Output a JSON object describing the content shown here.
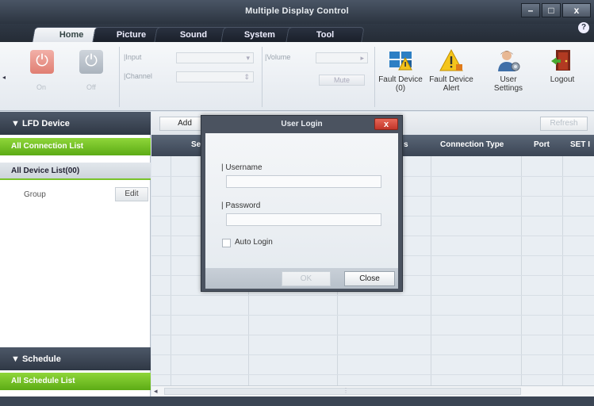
{
  "window": {
    "title": "Multiple Display Control",
    "controls": {
      "minimize": "–",
      "maximize": "□",
      "close": "x"
    }
  },
  "tabs": [
    {
      "label": "Home",
      "active": true
    },
    {
      "label": "Picture",
      "active": false
    },
    {
      "label": "Sound",
      "active": false
    },
    {
      "label": "System",
      "active": false
    },
    {
      "label": "Tool",
      "active": false
    }
  ],
  "help_label": "?",
  "ribbon": {
    "collapse_arrow": "◂",
    "power_on_label": "On",
    "power_off_label": "Off",
    "input_label": "Input",
    "channel_label": "Channel",
    "volume_label": "Volume",
    "mute_label": "Mute",
    "input_arrow": "▾",
    "channel_arrow": "⇕",
    "volume_arrow": "▸",
    "buttons": [
      {
        "label": "Fault Device (0)",
        "icon": "fault-device-icon"
      },
      {
        "label": "Fault Device Alert",
        "icon": "warning-icon"
      },
      {
        "label": "User Settings",
        "icon": "user-settings-icon"
      },
      {
        "label": "Logout",
        "icon": "logout-door-icon"
      }
    ]
  },
  "sidebar": {
    "lfd_header": "▼ LFD Device",
    "all_connection": "All Connection List",
    "all_device": "All Device List(00)",
    "group_label": "Group",
    "edit_label": "Edit",
    "schedule_header": "▼ Schedule",
    "all_schedule": "All Schedule List"
  },
  "toolbar": {
    "add_label": "Add",
    "refresh_label": "Refresh"
  },
  "grid": {
    "columns": [
      "Se",
      "s",
      "Connection Type",
      "Port",
      "SET I"
    ]
  },
  "scroll": {
    "left_arrow": "◂",
    "thumb_mark": "⋮"
  },
  "dialog": {
    "title": "User Login",
    "close_label": "x",
    "username_label": "Username",
    "username_value": "",
    "password_label": "Password",
    "password_value": "",
    "auto_login_label": "Auto Login",
    "ok_label": "OK",
    "close_button_label": "Close"
  },
  "colors": {
    "accent_green": "#6bbf1f",
    "header_dark": "#3b4554",
    "dialog_close_red": "#d4473a"
  }
}
